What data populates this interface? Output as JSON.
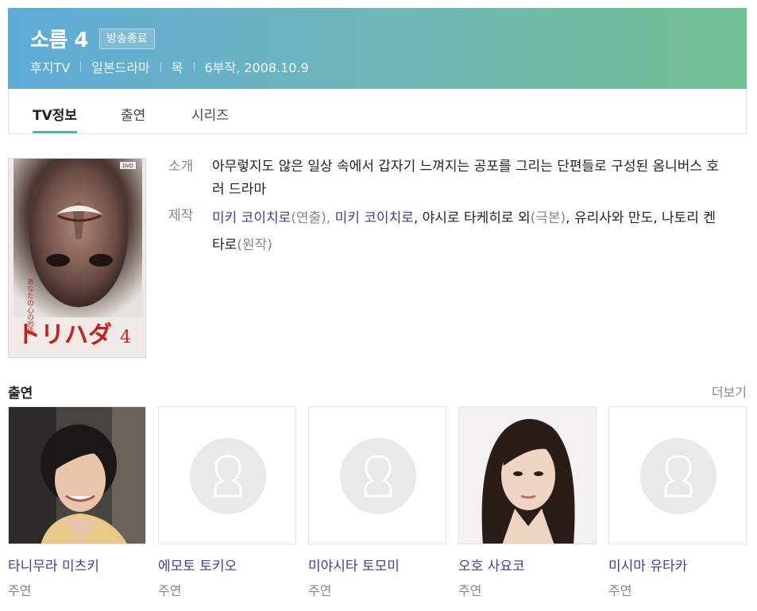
{
  "header": {
    "title": "소름 4",
    "badge": "방송종료",
    "meta": [
      "후지TV",
      "일본드라마",
      "목",
      "6부작, 2008.10.9"
    ],
    "gradient": [
      "#5fabd8",
      "#72c193"
    ]
  },
  "tabs": [
    {
      "label": "TV정보",
      "active": true
    },
    {
      "label": "출연",
      "active": false
    },
    {
      "label": "시리즈",
      "active": false
    }
  ],
  "poster": {
    "dvd_mark": "DVD",
    "side_text": "あなたの心の恐怖",
    "title_jp": "トリハダ",
    "title_num": "4"
  },
  "info": {
    "intro_label": "소개",
    "intro_text": "아무렇지도 않은 일상 속에서 갑자기 느껴지는 공포를 그리는 단편들로 구성된 옴니버스 호러 드라마",
    "production_label": "제작",
    "production": {
      "p1": "미키 코이치로",
      "r1": "(연출), ",
      "p2": "미키 코이치로",
      "p3": ", 야시로 타케히로 외",
      "r2": "(극본)",
      "p4": ", 유리사와 만도, 나토리 켄타로",
      "r3": "(원작)"
    }
  },
  "cast_section": {
    "heading": "출연",
    "more": "더보기",
    "members": [
      {
        "name": "타니무라 미츠키",
        "role": "주연",
        "photo": "photo"
      },
      {
        "name": "에모토 토키오",
        "role": "주연",
        "photo": "placeholder"
      },
      {
        "name": "미야시타 토모미",
        "role": "주연",
        "photo": "placeholder"
      },
      {
        "name": "오호 사요코",
        "role": "주연",
        "photo": "photo"
      },
      {
        "name": "미시마 유타카",
        "role": "주연",
        "photo": "placeholder"
      }
    ]
  },
  "colors": {
    "link": "#3c3fa4",
    "tab_underline": "#5ab0a9",
    "muted": "#888888"
  }
}
